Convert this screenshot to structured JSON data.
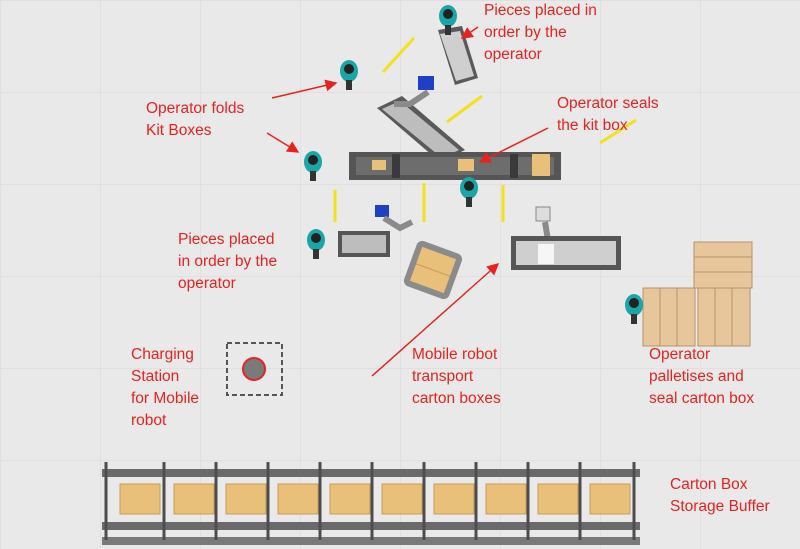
{
  "annotations": {
    "pieces_top": "Pieces placed in\norder by the\noperator",
    "operator_folds": "Operator folds\nKit Boxes",
    "operator_seals": "Operator seals\nthe kit box",
    "pieces_mid": "Pieces placed\nin order by the\noperator",
    "charging_station": "Charging\nStation\nfor Mobile\nrobot",
    "mobile_robot": "Mobile robot\ntransport\ncarton boxes",
    "operator_palletises": "Operator\npalletises and\nseal carton box",
    "storage_buffer": "Carton Box\nStorage Buffer"
  },
  "colors": {
    "background": "#e9e9e9",
    "grid": "#d8d8d8",
    "label": "#e8231f",
    "conveyor": "#5a5a5a",
    "operator": "#1aa6a6",
    "robot_arm": "#8a8a8a",
    "gripper": "#1f3fc8",
    "box": "#e9c07a",
    "pallet": "#e8c69c",
    "guard": "#f2e21a",
    "rack": "#6a6a6a"
  },
  "icons": [
    "operator-figure",
    "robot-arm",
    "conveyor",
    "mobile-robot",
    "pallet",
    "charging-station",
    "storage-rack"
  ]
}
